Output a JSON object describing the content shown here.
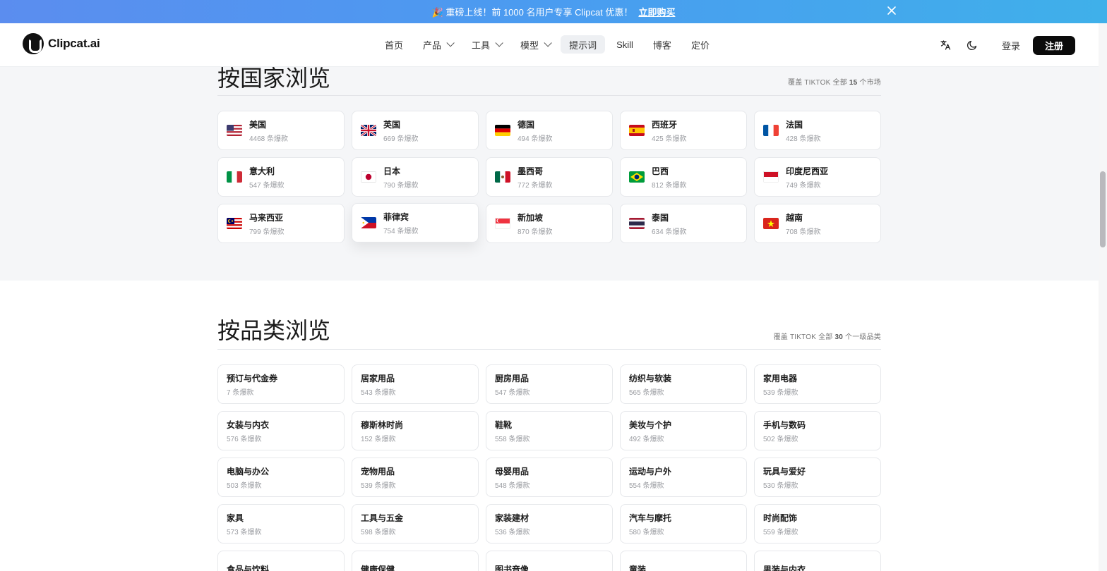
{
  "announcement": {
    "text": "🎉 重磅上线！前 1000 名用户专享 Clipcat 优惠！",
    "cta": "立即购买"
  },
  "brand": {
    "name": "Clipcat.ai"
  },
  "nav": {
    "items": [
      {
        "label": "首页",
        "dropdown": false,
        "active": false
      },
      {
        "label": "产品",
        "dropdown": true,
        "active": false
      },
      {
        "label": "工具",
        "dropdown": true,
        "active": false
      },
      {
        "label": "模型",
        "dropdown": true,
        "active": false
      },
      {
        "label": "提示词",
        "dropdown": false,
        "active": true
      },
      {
        "label": "Skill",
        "dropdown": false,
        "active": false
      },
      {
        "label": "博客",
        "dropdown": false,
        "active": false
      },
      {
        "label": "定价",
        "dropdown": false,
        "active": false
      }
    ],
    "login": "登录",
    "signup": "注册"
  },
  "countries": {
    "title": "按国家浏览",
    "subtitle_prefix": "覆盖 TIKTOK 全部 ",
    "subtitle_count": "15",
    "subtitle_suffix": " 个市场",
    "items": [
      {
        "name": "美国",
        "count": "4468 条爆款",
        "flag": "us"
      },
      {
        "name": "英国",
        "count": "669 条爆款",
        "flag": "gb"
      },
      {
        "name": "德国",
        "count": "494 条爆款",
        "flag": "de"
      },
      {
        "name": "西班牙",
        "count": "425 条爆款",
        "flag": "es"
      },
      {
        "name": "法国",
        "count": "428 条爆款",
        "flag": "fr"
      },
      {
        "name": "意大利",
        "count": "547 条爆款",
        "flag": "it"
      },
      {
        "name": "日本",
        "count": "790 条爆款",
        "flag": "jp"
      },
      {
        "name": "墨西哥",
        "count": "772 条爆款",
        "flag": "mx"
      },
      {
        "name": "巴西",
        "count": "812 条爆款",
        "flag": "br"
      },
      {
        "name": "印度尼西亚",
        "count": "749 条爆款",
        "flag": "id"
      },
      {
        "name": "马来西亚",
        "count": "799 条爆款",
        "flag": "my"
      },
      {
        "name": "菲律宾",
        "count": "754 条爆款",
        "flag": "ph"
      },
      {
        "name": "新加坡",
        "count": "870 条爆款",
        "flag": "sg"
      },
      {
        "name": "泰国",
        "count": "634 条爆款",
        "flag": "th"
      },
      {
        "name": "越南",
        "count": "708 条爆款",
        "flag": "vn"
      }
    ]
  },
  "categories": {
    "title": "按品类浏览",
    "subtitle_prefix": "覆盖 TIKTOK 全部 ",
    "subtitle_count": "30",
    "subtitle_suffix": " 个一级品类",
    "items": [
      {
        "name": "预订与代金券",
        "count": "7 条爆款"
      },
      {
        "name": "居家用品",
        "count": "543 条爆款"
      },
      {
        "name": "厨房用品",
        "count": "547 条爆款"
      },
      {
        "name": "纺织与软装",
        "count": "565 条爆款"
      },
      {
        "name": "家用电器",
        "count": "539 条爆款"
      },
      {
        "name": "女装与内衣",
        "count": "576 条爆款"
      },
      {
        "name": "穆斯林时尚",
        "count": "152 条爆款"
      },
      {
        "name": "鞋靴",
        "count": "558 条爆款"
      },
      {
        "name": "美妆与个护",
        "count": "492 条爆款"
      },
      {
        "name": "手机与数码",
        "count": "502 条爆款"
      },
      {
        "name": "电脑与办公",
        "count": "503 条爆款"
      },
      {
        "name": "宠物用品",
        "count": "539 条爆款"
      },
      {
        "name": "母婴用品",
        "count": "548 条爆款"
      },
      {
        "name": "运动与户外",
        "count": "554 条爆款"
      },
      {
        "name": "玩具与爱好",
        "count": "530 条爆款"
      },
      {
        "name": "家具",
        "count": "573 条爆款"
      },
      {
        "name": "工具与五金",
        "count": "598 条爆款"
      },
      {
        "name": "家装建材",
        "count": "536 条爆款"
      },
      {
        "name": "汽车与摩托",
        "count": "580 条爆款"
      },
      {
        "name": "时尚配饰",
        "count": "559 条爆款"
      },
      {
        "name": "食品与饮料",
        "count": ""
      },
      {
        "name": "健康保健",
        "count": ""
      },
      {
        "name": "图书音像",
        "count": ""
      },
      {
        "name": "童装",
        "count": ""
      },
      {
        "name": "男装与内衣",
        "count": ""
      }
    ]
  }
}
